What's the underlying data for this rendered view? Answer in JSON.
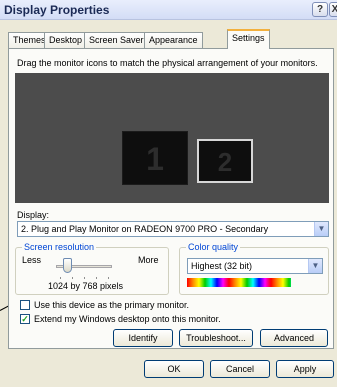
{
  "window": {
    "title": "Display Properties",
    "help_glyph": "?",
    "close_glyph": "X"
  },
  "tabs": [
    {
      "label": "Themes"
    },
    {
      "label": "Desktop"
    },
    {
      "label": "Screen Saver"
    },
    {
      "label": "Appearance"
    },
    {
      "label": "Settings",
      "active": true
    }
  ],
  "settings": {
    "instruction": "Drag the monitor icons to match the physical arrangement of your monitors.",
    "monitors": [
      {
        "number": "1"
      },
      {
        "number": "2"
      }
    ],
    "display_label": "Display:",
    "display_value": "2. Plug and Play Monitor on RADEON 9700 PRO - Secondary",
    "screen_resolution": {
      "title": "Screen resolution",
      "less": "Less",
      "more": "More",
      "value": "1024 by 768 pixels",
      "level": 0.2
    },
    "color_quality": {
      "title": "Color quality",
      "value": "Highest (32 bit)"
    },
    "primary_checkbox": {
      "label": "Use this device as the primary monitor.",
      "checked": false
    },
    "extend_checkbox": {
      "label": "Extend my Windows desktop onto this monitor.",
      "checked": true,
      "check_glyph": "✓"
    },
    "buttons": {
      "identify": "Identify",
      "troubleshoot": "Troubleshoot...",
      "advanced": "Advanced"
    }
  },
  "footer_buttons": {
    "ok": "OK",
    "cancel": "Cancel",
    "apply": "Apply"
  },
  "colors": {
    "title_text": "#1b2a55",
    "dialog_bg": "#ece9d8",
    "monitor_area": "#4c4c4c",
    "group_title": "#0046d5",
    "active_tab_accent": "#f3b03d"
  }
}
